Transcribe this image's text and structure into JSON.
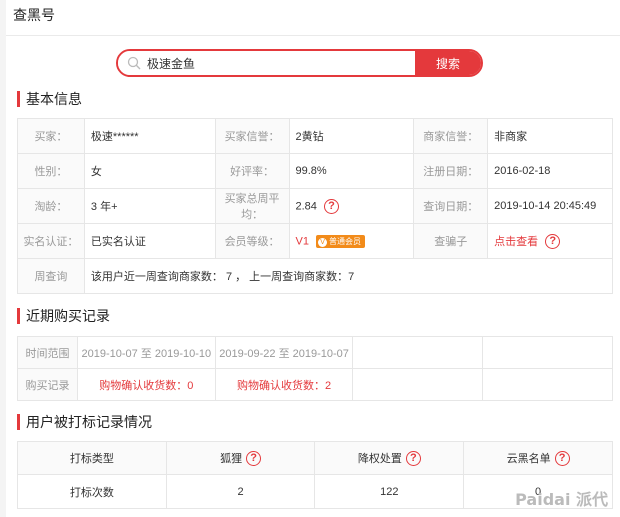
{
  "header": {
    "title": "查黑号"
  },
  "search": {
    "value": "极速金鱼",
    "button_label": "搜索"
  },
  "basic_info": {
    "title": "基本信息",
    "rows": [
      [
        {
          "label": "买家："
        },
        {
          "value": "极速******"
        },
        {
          "label": "买家信誉："
        },
        {
          "value": "2黄钻"
        },
        {
          "label": "商家信誉："
        },
        {
          "value": "非商家"
        }
      ],
      [
        {
          "label": "性别："
        },
        {
          "value": "女"
        },
        {
          "label": "好评率："
        },
        {
          "value": "99.8%"
        },
        {
          "label": "注册日期："
        },
        {
          "value": "2016-02-18"
        }
      ],
      [
        {
          "label": "淘龄："
        },
        {
          "value": "3 年+"
        },
        {
          "label": "买家总周平均："
        },
        {
          "value": "2.84"
        },
        {
          "label": "查询日期："
        },
        {
          "value": "2019-10-14 20:45:49"
        }
      ],
      [
        {
          "label": "实名认证："
        },
        {
          "value": "已实名认证"
        },
        {
          "label": "会员等级："
        },
        {
          "value": "V1"
        },
        {
          "label": "查骗子"
        },
        {
          "value": "点击查看"
        }
      ]
    ],
    "member_badge": "普通会员",
    "member_badge_icon": "v-circle-icon",
    "week_query_label": "周查询",
    "week_query_text": "该用户近一周查询商家数： 7 ， 上一周查询商家数：7"
  },
  "recent": {
    "title": "近期购买记录",
    "range_label": "时间范围",
    "records_label": "购买记录",
    "ranges": [
      "2019-10-07 至 2019-10-10",
      "2019-09-22 至 2019-10-07"
    ],
    "counts": [
      "购物确认收货数：0",
      "购物确认收货数：2"
    ]
  },
  "marks": {
    "title": "用户被打标记录情况",
    "headers": [
      "打标类型",
      "狐狸",
      "降权处置",
      "云黑名单"
    ],
    "row_label": "打标次数",
    "values": [
      "2",
      "122",
      "0"
    ]
  },
  "help_symbol": "?",
  "watermark": "Paidai 派代",
  "colors": {
    "accent": "#e4393c",
    "badge": "#f28b1a"
  }
}
